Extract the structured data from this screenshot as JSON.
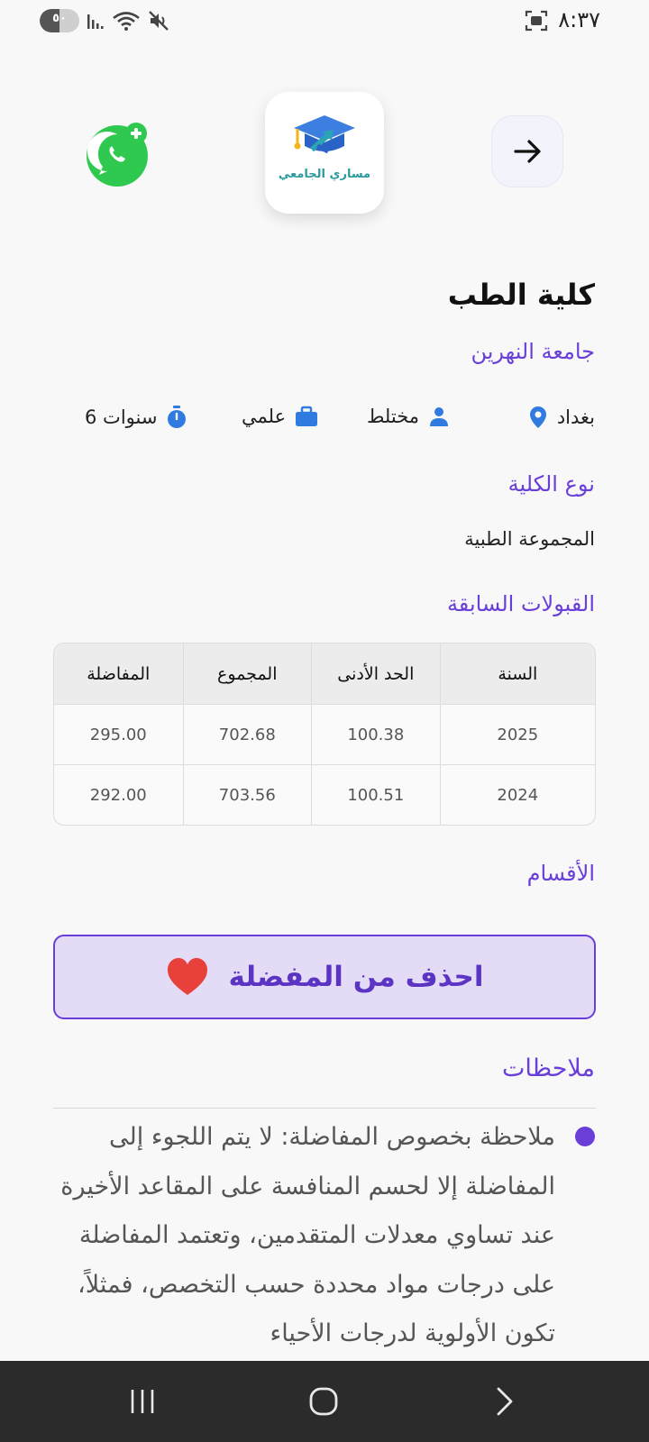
{
  "status_bar": {
    "time": "٨:٣٧",
    "battery": "٥٠",
    "battery_level": 0.5
  },
  "header": {
    "logo_text": "مساري الجامعي"
  },
  "college": {
    "title": "كلية الطب",
    "university": "جامعة النهرين",
    "meta": {
      "location": "بغداد",
      "gender": "مختلط",
      "branch": "علمي",
      "duration": "6 سنوات"
    }
  },
  "college_type": {
    "heading": "نوع الكلية",
    "value": "المجموعة الطبية"
  },
  "admissions": {
    "heading": "القبولات السابقة",
    "columns": [
      "السنة",
      "الحد الأدنى",
      "المجموع",
      "المفاضلة"
    ],
    "rows": [
      [
        "2025",
        "100.38",
        "702.68",
        "295.00"
      ],
      [
        "2024",
        "100.51",
        "703.56",
        "292.00"
      ]
    ]
  },
  "departments": {
    "heading": "الأقسام"
  },
  "favorite": {
    "label": "احذف من المفضلة"
  },
  "notes": {
    "heading": "ملاحظات",
    "items": [
      "ملاحظة بخصوص المفاضلة: لا يتم اللجوء إلى المفاضلة إلا لحسم المنافسة على المقاعد الأخيرة عند تساوي معدلات المتقدمين، وتعتمد المفاضلة على درجات مواد محددة حسب التخصص، فمثلاً، تكون الأولوية لدرجات الأحياء"
    ]
  },
  "colors": {
    "accent": "#6a3fd8",
    "favorite_bg": "#e4dcf7",
    "heart": "#e8413b",
    "whatsapp": "#2fc94f"
  }
}
